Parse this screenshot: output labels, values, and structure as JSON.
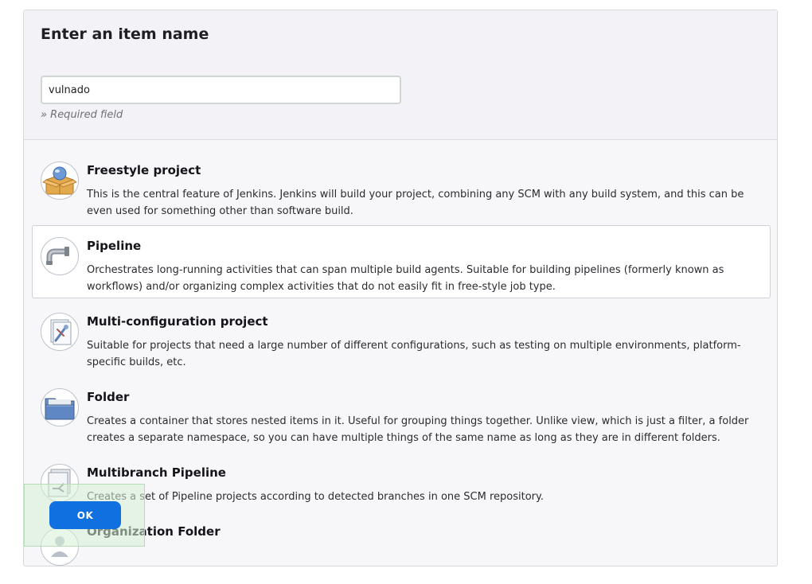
{
  "form": {
    "title": "Enter an item name",
    "item_name_value": "vulnado",
    "required_hint": "» Required field"
  },
  "item_types": [
    {
      "title": "Freestyle project",
      "description": "This is the central feature of Jenkins. Jenkins will build your project, combining any SCM with any build system, and this can be even used for something other than software build.",
      "icon": "freestyle-project-icon",
      "selected": false
    },
    {
      "title": "Pipeline",
      "description": "Orchestrates long-running activities that can span multiple build agents. Suitable for building pipelines (formerly known as workflows) and/or organizing complex activities that do not easily fit in free-style job type.",
      "icon": "pipeline-icon",
      "selected": true
    },
    {
      "title": "Multi-configuration project",
      "description": "Suitable for projects that need a large number of different configurations, such as testing on multiple environments, platform-specific builds, etc.",
      "icon": "multi-configuration-icon",
      "selected": false
    },
    {
      "title": "Folder",
      "description": "Creates a container that stores nested items in it. Useful for grouping things together. Unlike view, which is just a filter, a folder creates a separate namespace, so you can have multiple things of the same name as long as they are in different folders.",
      "icon": "folder-icon",
      "selected": false
    },
    {
      "title": "Multibranch Pipeline",
      "description": "Creates a set of Pipeline projects according to detected branches in one SCM repository.",
      "icon": "multibranch-pipeline-icon",
      "selected": false
    },
    {
      "title": "Organization Folder",
      "description": "",
      "icon": "organization-folder-icon",
      "selected": false
    }
  ],
  "actions": {
    "ok_label": "OK"
  },
  "colors": {
    "primary_button": "#1170e0",
    "selected_item_bg": "#ffffff",
    "header_bg": "#f2f2f7"
  }
}
